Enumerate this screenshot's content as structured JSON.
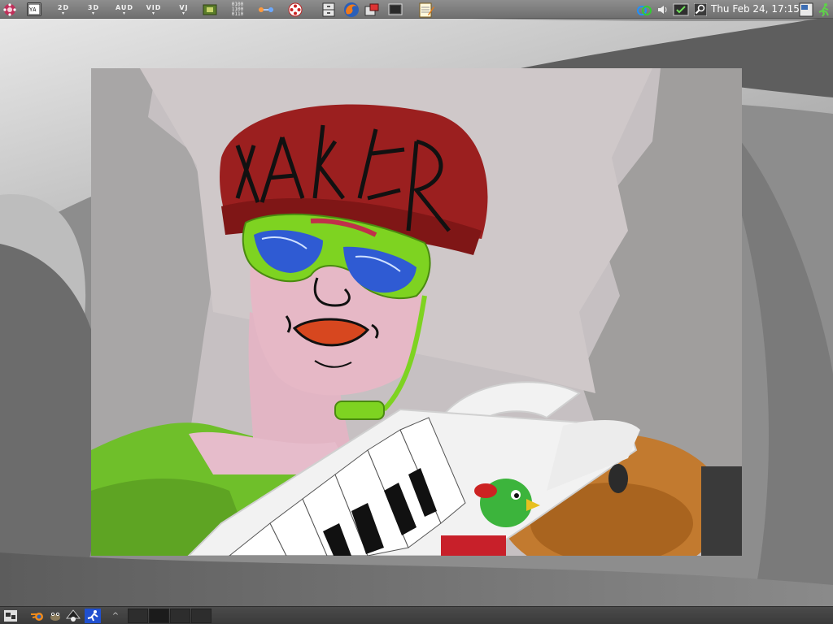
{
  "top_panel": {
    "menus": [
      {
        "label": "2D"
      },
      {
        "label": "3D"
      },
      {
        "label": "AUD"
      },
      {
        "label": "VID"
      },
      {
        "label": "VJ"
      }
    ],
    "binary_icon_text": "0100\n1100\n0110",
    "clock": "Thu Feb 24, 17:15"
  },
  "icons": {
    "app_menu": "distro-logo-icon",
    "terminal_launcher": "yao-terminal-icon",
    "browser": "firefox-icon",
    "notepad": "text-editor-icon",
    "quit": "run-exit-icon"
  },
  "colors": {
    "panel_top": "#8e8e8e",
    "panel_bottom": "#444444",
    "wall": "#c9c4c5",
    "cap": "#9b1f1f",
    "face": "#e6b8c6",
    "shirt": "#6fbf2a",
    "glasses_frame": "#7ed321",
    "glasses_lens": "#2f5bd3",
    "keytar": "#f2f2f2"
  }
}
